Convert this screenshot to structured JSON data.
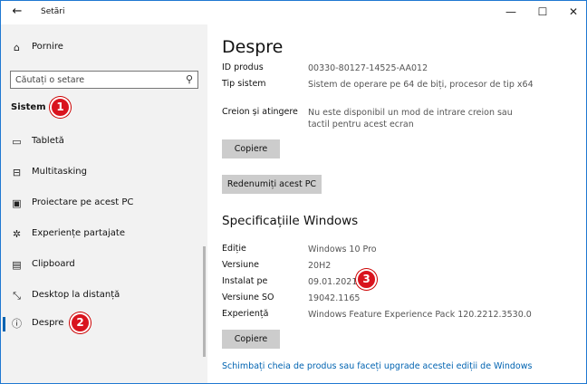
{
  "window": {
    "title": "Setări"
  },
  "sidebar": {
    "home_label": "Pornire",
    "search_placeholder": "Căutați o setare",
    "section_label": "Sistem",
    "items": [
      {
        "label": "Tabletă",
        "icon": "tablet-icon"
      },
      {
        "label": "Multitasking",
        "icon": "multitasking-icon"
      },
      {
        "label": "Proiectare pe acest PC",
        "icon": "project-icon"
      },
      {
        "label": "Experiențe partajate",
        "icon": "shared-experiences-icon"
      },
      {
        "label": "Clipboard",
        "icon": "clipboard-icon"
      },
      {
        "label": "Desktop la distanță",
        "icon": "remote-desktop-icon"
      },
      {
        "label": "Despre",
        "icon": "info-icon",
        "selected": true
      }
    ]
  },
  "main": {
    "title": "Despre",
    "device_specs": [
      {
        "key": "ID produs",
        "value": "00330-80127-14525-AA012"
      },
      {
        "key": "Tip sistem",
        "value": "Sistem de operare pe 64 de biți, procesor de tip x64"
      },
      {
        "key": "Creion și atingere",
        "value": "Nu este disponibil un mod de intrare creion sau tactil pentru acest ecran"
      }
    ],
    "copy_button": "Copiere",
    "rename_button": "Redenumiți acest PC",
    "windows_specs_title": "Specificațiile Windows",
    "windows_specs": [
      {
        "key": "Ediție",
        "value": "Windows 10 Pro"
      },
      {
        "key": "Versiune",
        "value": "20H2"
      },
      {
        "key": "Instalat pe",
        "value": "09.01.2021"
      },
      {
        "key": "Versiune SO",
        "value": "19042.1165"
      },
      {
        "key": "Experiență",
        "value": "Windows Feature Experience Pack 120.2212.3530.0"
      }
    ],
    "copy_button_2": "Copiere",
    "upgrade_link": "Schimbați cheia de produs sau faceți upgrade acestei ediții de Windows"
  },
  "badges": [
    "1",
    "2",
    "3"
  ],
  "colors": {
    "accent": "#0063b1",
    "badge": "#d9141e",
    "sidebar_bg": "#f2f2f2",
    "button_bg": "#cccccc"
  }
}
